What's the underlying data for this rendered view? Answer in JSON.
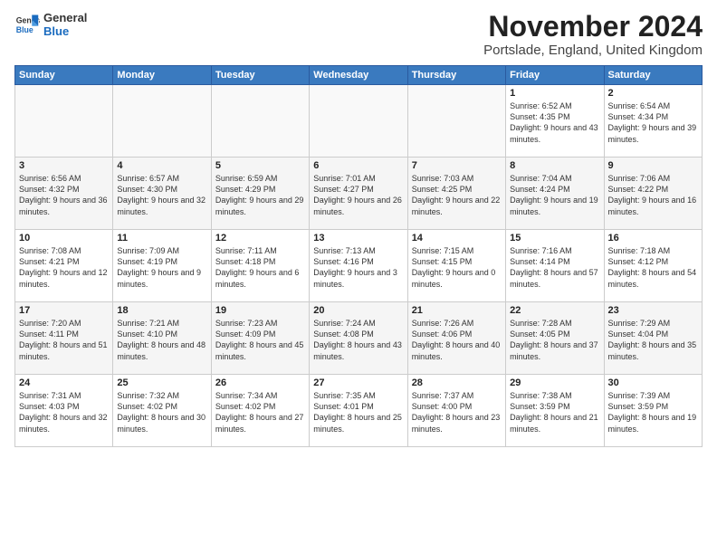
{
  "logo": {
    "general": "General",
    "blue": "Blue"
  },
  "header": {
    "month": "November 2024",
    "location": "Portslade, England, United Kingdom"
  },
  "weekdays": [
    "Sunday",
    "Monday",
    "Tuesday",
    "Wednesday",
    "Thursday",
    "Friday",
    "Saturday"
  ],
  "rows": [
    [
      {
        "day": "",
        "info": ""
      },
      {
        "day": "",
        "info": ""
      },
      {
        "day": "",
        "info": ""
      },
      {
        "day": "",
        "info": ""
      },
      {
        "day": "",
        "info": ""
      },
      {
        "day": "1",
        "info": "Sunrise: 6:52 AM\nSunset: 4:35 PM\nDaylight: 9 hours and 43 minutes."
      },
      {
        "day": "2",
        "info": "Sunrise: 6:54 AM\nSunset: 4:34 PM\nDaylight: 9 hours and 39 minutes."
      }
    ],
    [
      {
        "day": "3",
        "info": "Sunrise: 6:56 AM\nSunset: 4:32 PM\nDaylight: 9 hours and 36 minutes."
      },
      {
        "day": "4",
        "info": "Sunrise: 6:57 AM\nSunset: 4:30 PM\nDaylight: 9 hours and 32 minutes."
      },
      {
        "day": "5",
        "info": "Sunrise: 6:59 AM\nSunset: 4:29 PM\nDaylight: 9 hours and 29 minutes."
      },
      {
        "day": "6",
        "info": "Sunrise: 7:01 AM\nSunset: 4:27 PM\nDaylight: 9 hours and 26 minutes."
      },
      {
        "day": "7",
        "info": "Sunrise: 7:03 AM\nSunset: 4:25 PM\nDaylight: 9 hours and 22 minutes."
      },
      {
        "day": "8",
        "info": "Sunrise: 7:04 AM\nSunset: 4:24 PM\nDaylight: 9 hours and 19 minutes."
      },
      {
        "day": "9",
        "info": "Sunrise: 7:06 AM\nSunset: 4:22 PM\nDaylight: 9 hours and 16 minutes."
      }
    ],
    [
      {
        "day": "10",
        "info": "Sunrise: 7:08 AM\nSunset: 4:21 PM\nDaylight: 9 hours and 12 minutes."
      },
      {
        "day": "11",
        "info": "Sunrise: 7:09 AM\nSunset: 4:19 PM\nDaylight: 9 hours and 9 minutes."
      },
      {
        "day": "12",
        "info": "Sunrise: 7:11 AM\nSunset: 4:18 PM\nDaylight: 9 hours and 6 minutes."
      },
      {
        "day": "13",
        "info": "Sunrise: 7:13 AM\nSunset: 4:16 PM\nDaylight: 9 hours and 3 minutes."
      },
      {
        "day": "14",
        "info": "Sunrise: 7:15 AM\nSunset: 4:15 PM\nDaylight: 9 hours and 0 minutes."
      },
      {
        "day": "15",
        "info": "Sunrise: 7:16 AM\nSunset: 4:14 PM\nDaylight: 8 hours and 57 minutes."
      },
      {
        "day": "16",
        "info": "Sunrise: 7:18 AM\nSunset: 4:12 PM\nDaylight: 8 hours and 54 minutes."
      }
    ],
    [
      {
        "day": "17",
        "info": "Sunrise: 7:20 AM\nSunset: 4:11 PM\nDaylight: 8 hours and 51 minutes."
      },
      {
        "day": "18",
        "info": "Sunrise: 7:21 AM\nSunset: 4:10 PM\nDaylight: 8 hours and 48 minutes."
      },
      {
        "day": "19",
        "info": "Sunrise: 7:23 AM\nSunset: 4:09 PM\nDaylight: 8 hours and 45 minutes."
      },
      {
        "day": "20",
        "info": "Sunrise: 7:24 AM\nSunset: 4:08 PM\nDaylight: 8 hours and 43 minutes."
      },
      {
        "day": "21",
        "info": "Sunrise: 7:26 AM\nSunset: 4:06 PM\nDaylight: 8 hours and 40 minutes."
      },
      {
        "day": "22",
        "info": "Sunrise: 7:28 AM\nSunset: 4:05 PM\nDaylight: 8 hours and 37 minutes."
      },
      {
        "day": "23",
        "info": "Sunrise: 7:29 AM\nSunset: 4:04 PM\nDaylight: 8 hours and 35 minutes."
      }
    ],
    [
      {
        "day": "24",
        "info": "Sunrise: 7:31 AM\nSunset: 4:03 PM\nDaylight: 8 hours and 32 minutes."
      },
      {
        "day": "25",
        "info": "Sunrise: 7:32 AM\nSunset: 4:02 PM\nDaylight: 8 hours and 30 minutes."
      },
      {
        "day": "26",
        "info": "Sunrise: 7:34 AM\nSunset: 4:02 PM\nDaylight: 8 hours and 27 minutes."
      },
      {
        "day": "27",
        "info": "Sunrise: 7:35 AM\nSunset: 4:01 PM\nDaylight: 8 hours and 25 minutes."
      },
      {
        "day": "28",
        "info": "Sunrise: 7:37 AM\nSunset: 4:00 PM\nDaylight: 8 hours and 23 minutes."
      },
      {
        "day": "29",
        "info": "Sunrise: 7:38 AM\nSunset: 3:59 PM\nDaylight: 8 hours and 21 minutes."
      },
      {
        "day": "30",
        "info": "Sunrise: 7:39 AM\nSunset: 3:59 PM\nDaylight: 8 hours and 19 minutes."
      }
    ]
  ]
}
